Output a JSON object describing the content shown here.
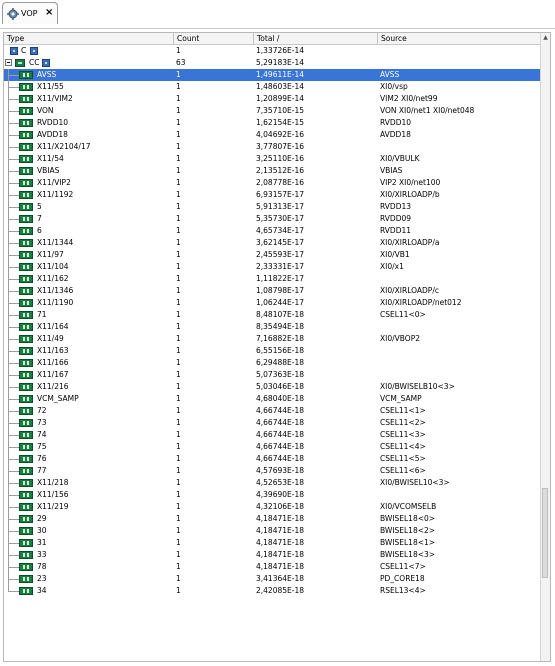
{
  "tab": {
    "title": "VOP",
    "close": "×"
  },
  "columns": {
    "type": "Type",
    "count": "Count",
    "total": "Total /",
    "source": "Source"
  },
  "top_rows": [
    {
      "name": "C",
      "count": "1",
      "total": "1,33726E-14",
      "source": ""
    },
    {
      "name": "CC",
      "count": "63",
      "total": "5,29183E-14",
      "source": ""
    }
  ],
  "rows": [
    {
      "name": "AVSS",
      "count": "1",
      "total": "1,49611E-14",
      "source": "AVSS"
    },
    {
      "name": "X11/55",
      "count": "1",
      "total": "1,48603E-14",
      "source": "XI0/vsp"
    },
    {
      "name": "X11/VIM2",
      "count": "1",
      "total": "1,20899E-14",
      "source": "VIM2 XI0/net99"
    },
    {
      "name": "VON",
      "count": "1",
      "total": "7,35710E-15",
      "source": "VON XI0/net1 XI0/net048"
    },
    {
      "name": "RVDD10",
      "count": "1",
      "total": "1,62154E-15",
      "source": "RVDD10"
    },
    {
      "name": "AVDD18",
      "count": "1",
      "total": "4,04692E-16",
      "source": "AVDD18"
    },
    {
      "name": "X11/X2104/17",
      "count": "1",
      "total": "3,77807E-16",
      "source": ""
    },
    {
      "name": "X11/54",
      "count": "1",
      "total": "3,25110E-16",
      "source": "XI0/VBULK"
    },
    {
      "name": "VBIAS",
      "count": "1",
      "total": "2,13512E-16",
      "source": "VBIAS"
    },
    {
      "name": "X11/VIP2",
      "count": "1",
      "total": "2,08778E-16",
      "source": "VIP2 XI0/net100"
    },
    {
      "name": "X11/1192",
      "count": "1",
      "total": "6,93157E-17",
      "source": "XI0/XIRLOADP/b"
    },
    {
      "name": "5",
      "count": "1",
      "total": "5,91313E-17",
      "source": "RVDD13"
    },
    {
      "name": "7",
      "count": "1",
      "total": "5,35730E-17",
      "source": "RVDD09"
    },
    {
      "name": "6",
      "count": "1",
      "total": "4,65734E-17",
      "source": "RVDD11"
    },
    {
      "name": "X11/1344",
      "count": "1",
      "total": "3,62145E-17",
      "source": "XI0/XIRLOADP/a"
    },
    {
      "name": "X11/97",
      "count": "1",
      "total": "2,45593E-17",
      "source": "XI0/VB1"
    },
    {
      "name": "X11/104",
      "count": "1",
      "total": "2,33331E-17",
      "source": "XI0/x1"
    },
    {
      "name": "X11/162",
      "count": "1",
      "total": "1,11822E-17",
      "source": ""
    },
    {
      "name": "X11/1346",
      "count": "1",
      "total": "1,08798E-17",
      "source": "XI0/XIRLOADP/c"
    },
    {
      "name": "X11/1190",
      "count": "1",
      "total": "1,06244E-17",
      "source": "XI0/XIRLOADP/net012"
    },
    {
      "name": "71",
      "count": "1",
      "total": "8,48107E-18",
      "source": "CSEL11<0>"
    },
    {
      "name": "X11/164",
      "count": "1",
      "total": "8,35494E-18",
      "source": ""
    },
    {
      "name": "X11/49",
      "count": "1",
      "total": "7,16882E-18",
      "source": "XI0/VBOP2"
    },
    {
      "name": "X11/163",
      "count": "1",
      "total": "6,55156E-18",
      "source": ""
    },
    {
      "name": "X11/166",
      "count": "1",
      "total": "6,29488E-18",
      "source": ""
    },
    {
      "name": "X11/167",
      "count": "1",
      "total": "5,07363E-18",
      "source": ""
    },
    {
      "name": "X11/216",
      "count": "1",
      "total": "5,03046E-18",
      "source": "XI0/BWISELB10<3>"
    },
    {
      "name": "VCM_SAMP",
      "count": "1",
      "total": "4,68040E-18",
      "source": "VCM_SAMP"
    },
    {
      "name": "72",
      "count": "1",
      "total": "4,66744E-18",
      "source": "CSEL11<1>"
    },
    {
      "name": "73",
      "count": "1",
      "total": "4,66744E-18",
      "source": "CSEL11<2>"
    },
    {
      "name": "74",
      "count": "1",
      "total": "4,66744E-18",
      "source": "CSEL11<3>"
    },
    {
      "name": "75",
      "count": "1",
      "total": "4,66744E-18",
      "source": "CSEL11<4>"
    },
    {
      "name": "76",
      "count": "1",
      "total": "4,66744E-18",
      "source": "CSEL11<5>"
    },
    {
      "name": "77",
      "count": "1",
      "total": "4,57693E-18",
      "source": "CSEL11<6>"
    },
    {
      "name": "X11/218",
      "count": "1",
      "total": "4,52653E-18",
      "source": "XI0/BWISEL10<3>"
    },
    {
      "name": "X11/156",
      "count": "1",
      "total": "4,39690E-18",
      "source": ""
    },
    {
      "name": "X11/219",
      "count": "1",
      "total": "4,32106E-18",
      "source": "XI0/VCOMSELB"
    },
    {
      "name": "29",
      "count": "1",
      "total": "4,18471E-18",
      "source": "BWISEL18<0>"
    },
    {
      "name": "30",
      "count": "1",
      "total": "4,18471E-18",
      "source": "BWISEL18<2>"
    },
    {
      "name": "31",
      "count": "1",
      "total": "4,18471E-18",
      "source": "BWISEL18<1>"
    },
    {
      "name": "33",
      "count": "1",
      "total": "4,18471E-18",
      "source": "BWISEL18<3>"
    },
    {
      "name": "78",
      "count": "1",
      "total": "4,18471E-18",
      "source": "CSEL11<7>"
    },
    {
      "name": "23",
      "count": "1",
      "total": "3,41364E-18",
      "source": "PD_CORE18"
    },
    {
      "name": "34",
      "count": "1",
      "total": "2,42085E-18",
      "source": "RSEL13<4>"
    }
  ],
  "selected_index": 0,
  "colors": {
    "selection": "#3875d7",
    "icon_green": "#16813f",
    "icon_blue": "#3a6fb6"
  },
  "icons": {
    "tab": "settings-gear-icon",
    "row": "capacitor-icon",
    "group": "cluster-icon"
  }
}
